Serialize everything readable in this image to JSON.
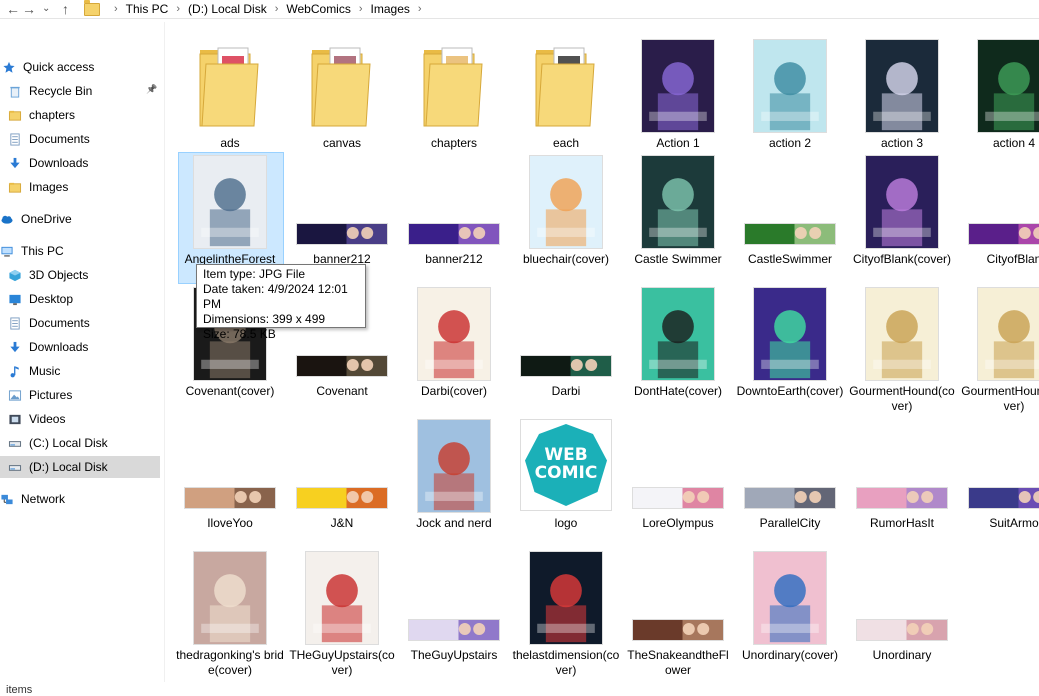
{
  "address": {
    "crumbs": [
      "This PC",
      "(D:) Local Disk",
      "WebComics",
      "Images"
    ]
  },
  "sidebar": {
    "items": [
      {
        "label": "Quick access",
        "icon": "star-icon",
        "color": "#2b7bd4"
      },
      {
        "label": "Recycle Bin",
        "icon": "recycle-bin-icon",
        "color": "#6aa3d8"
      },
      {
        "label": "chapters",
        "icon": "folder-icon",
        "color": "#f5d26b"
      },
      {
        "label": "Documents",
        "icon": "documents-icon",
        "color": "#7c9cc0"
      },
      {
        "label": "Downloads",
        "icon": "download-icon",
        "color": "#2b7bd4"
      },
      {
        "label": "Images",
        "icon": "folder-icon",
        "color": "#f5d26b"
      },
      {
        "label": "OneDrive",
        "icon": "cloud-icon",
        "color": "#1a73c8"
      },
      {
        "label": "This PC",
        "icon": "computer-icon",
        "color": "#3b8ad9"
      },
      {
        "label": "3D Objects",
        "icon": "cube-icon",
        "color": "#36a3d9"
      },
      {
        "label": "Desktop",
        "icon": "desktop-icon",
        "color": "#2a85d8"
      },
      {
        "label": "Documents",
        "icon": "documents-icon",
        "color": "#7c9cc0"
      },
      {
        "label": "Downloads",
        "icon": "download-icon",
        "color": "#2b7bd4"
      },
      {
        "label": "Music",
        "icon": "music-icon",
        "color": "#2b7bd4"
      },
      {
        "label": "Pictures",
        "icon": "pictures-icon",
        "color": "#6a9ccb"
      },
      {
        "label": "Videos",
        "icon": "videos-icon",
        "color": "#404a59"
      },
      {
        "label": "(C:) Local Disk",
        "icon": "drive-icon",
        "color": "#5a6a7a"
      },
      {
        "label": "(D:) Local Disk",
        "icon": "drive-icon",
        "color": "#5a6a7a"
      },
      {
        "label": "Network",
        "icon": "network-icon",
        "color": "#3b8ad9"
      }
    ]
  },
  "files": [
    {
      "label": "ads",
      "kind": "folder",
      "accent": "#d8324a"
    },
    {
      "label": "canvas",
      "kind": "folder",
      "accent": "#a55a6a"
    },
    {
      "label": "chapters",
      "kind": "folder",
      "accent": "#e8b86a"
    },
    {
      "label": "each",
      "kind": "folder",
      "accent": "#333333"
    },
    {
      "label": "Action 1",
      "kind": "img",
      "c1": "#2a1d4a",
      "c2": "#8a6ad8"
    },
    {
      "label": "action 2",
      "kind": "img",
      "c1": "#bfe6ee",
      "c2": "#3a8aa0"
    },
    {
      "label": "action 3",
      "kind": "img",
      "c1": "#1b2a3a",
      "c2": "#d9d9f0"
    },
    {
      "label": "action 4",
      "kind": "img",
      "c1": "#0f2a1c",
      "c2": "#3fa05a"
    },
    {
      "label": "AngelintheForest",
      "kind": "img",
      "c1": "#e9edf2",
      "c2": "#4a6a8a"
    },
    {
      "label": "banner212",
      "kind": "banner",
      "c1": "#1a1640",
      "c2": "#6a5ab8"
    },
    {
      "label": "banner212",
      "kind": "banner",
      "c1": "#3a1f8a",
      "c2": "#b07ae0"
    },
    {
      "label": "bluechair(cover)",
      "kind": "img",
      "c1": "#dff1fb",
      "c2": "#f0a050"
    },
    {
      "label": "Castle Swimmer",
      "kind": "img",
      "c1": "#1c3a3a",
      "c2": "#7fc7b0"
    },
    {
      "label": "CastleSwimmer",
      "kind": "banner",
      "c1": "#2a7a2a",
      "c2": "#cfe8b0"
    },
    {
      "label": "CityofBlank(cover)",
      "kind": "img",
      "c1": "#2a1f5a",
      "c2": "#c080e0"
    },
    {
      "label": "CityofBlan",
      "kind": "banner",
      "c1": "#5a1f8a",
      "c2": "#e060c0"
    },
    {
      "label": "Covenant(cover)",
      "kind": "img",
      "c1": "#1a1a1a",
      "c2": "#8a7a6a"
    },
    {
      "label": "Covenant",
      "kind": "banner",
      "c1": "#1a1410",
      "c2": "#7a6a50"
    },
    {
      "label": "Darbi(cover)",
      "kind": "img",
      "c1": "#f7f1e6",
      "c2": "#c82a2a"
    },
    {
      "label": "Darbi",
      "kind": "banner",
      "c1": "#0f1a14",
      "c2": "#2a8a6a"
    },
    {
      "label": "DontHate(cover)",
      "kind": "img",
      "c1": "#3ac0a0",
      "c2": "#1a1a1a"
    },
    {
      "label": "DowntoEarth(cover)",
      "kind": "img",
      "c1": "#3a2a8a",
      "c2": "#40e0a0"
    },
    {
      "label": "GourmentHound(cover)",
      "kind": "img",
      "c1": "#f6efd6",
      "c2": "#c8a050"
    },
    {
      "label": "GourmentHound(cover)",
      "kind": "img",
      "c1": "#f6efd6",
      "c2": "#c8a050"
    },
    {
      "label": "IloveYoo",
      "kind": "banner",
      "c1": "#d0a080",
      "c2": "#5a3a2a"
    },
    {
      "label": "J&N",
      "kind": "banner",
      "c1": "#f7d020",
      "c2": "#c82a2a"
    },
    {
      "label": "Jock and nerd",
      "kind": "img",
      "c1": "#9fc0e0",
      "c2": "#c83a2a"
    },
    {
      "label": "logo",
      "kind": "logo",
      "c1": "#1bb0b8",
      "c2": "#ffffff",
      "text": "WEB COMIC"
    },
    {
      "label": "LoreOlympus",
      "kind": "banner",
      "c1": "#f4f4f8",
      "c2": "#d03a6a"
    },
    {
      "label": "ParallelCity",
      "kind": "banner",
      "c1": "#a0a8b8",
      "c2": "#3a3a4a"
    },
    {
      "label": "RumorHasIt",
      "kind": "banner",
      "c1": "#e8a0c0",
      "c2": "#8a7ad0"
    },
    {
      "label": "SuitArmo",
      "kind": "banner",
      "c1": "#3a3a8a",
      "c2": "#8a5ad0"
    },
    {
      "label": "thedragonking's bride(cover)",
      "kind": "img",
      "c1": "#c8a8a0",
      "c2": "#f0e0d0"
    },
    {
      "label": "THeGuyUpstairs(cover)",
      "kind": "img",
      "c1": "#f4f0ec",
      "c2": "#c82a2a"
    },
    {
      "label": "TheGuyUpstairs",
      "kind": "banner",
      "c1": "#e0d8f0",
      "c2": "#5a3ab0"
    },
    {
      "label": "thelastdimension(cover)",
      "kind": "img",
      "c1": "#0f1a2a",
      "c2": "#e03a3a"
    },
    {
      "label": "TheSnakeandtheFlower",
      "kind": "banner",
      "c1": "#6a3a2a",
      "c2": "#d0a080"
    },
    {
      "label": "Unordinary(cover)",
      "kind": "img",
      "c1": "#f0c0d0",
      "c2": "#2a6ac0"
    },
    {
      "label": "Unordinary",
      "kind": "banner",
      "c1": "#f0e0e4",
      "c2": "#c87a8a"
    }
  ],
  "tooltip": {
    "lines": [
      "Item type: JPG File",
      "Date taken: 4/9/2024 12:01 PM",
      "Dimensions: 399 x 499",
      "Size: 78.5 KB"
    ]
  },
  "status": {
    "text": "items"
  }
}
